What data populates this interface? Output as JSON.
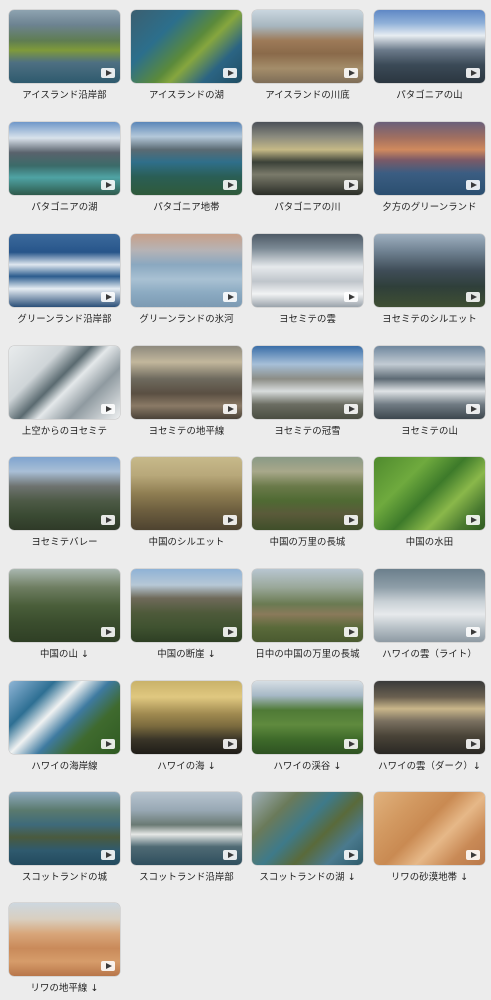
{
  "items": [
    {
      "label": "アイスランド沿岸部",
      "bg": "linear-gradient(180deg,#8ea3b0 0%,#6d8392 20%,#5f7d52 42%,#7f9a3a 55%,#4e6f82 72%,#2e5a6e 100%)"
    },
    {
      "label": "アイスランドの湖",
      "bg": "linear-gradient(135deg,#3b5f70 0%,#2c6f8c 30%,#5b8a3b 52%,#86a63e 60%,#2b6483 78%,#1f4d63 100%)"
    },
    {
      "label": "アイスランドの川底",
      "bg": "linear-gradient(180deg,#c9d6df 0%,#a7b6bf 22%,#9d7a58 42%,#8a6a4a 60%,#a48d6a 80%,#7e6d57 100%)"
    },
    {
      "label": "パタゴニアの山",
      "bg": "linear-gradient(180deg,#5f88c5 0%,#8fb0d8 18%,#e8edf2 35%,#6b7a8a 55%,#3b4a57 75%,#2b3640 100%)"
    },
    {
      "label": "パタゴニアの湖",
      "bg": "linear-gradient(180deg,#6f97c9 0%,#d9e2eb 22%,#59626c 42%,#3b6b69 60%,#4fa3a4 76%,#2e5a4c 100%)"
    },
    {
      "label": "パタゴニア地帯",
      "bg": "linear-gradient(180deg,#5a86b8 0%,#b4c8da 20%,#5a6a72 38%,#2f6f8a 55%,#2a5e55 75%,#2f5a3a 100%)"
    },
    {
      "label": "パタゴニアの川",
      "bg": "linear-gradient(180deg,#4b5058 0%,#8a8a7e 20%,#c5b986 38%,#3b4138 55%,#7a7a6a 72%,#2b2e28 100%)"
    },
    {
      "label": "夕方のグリーンランド",
      "bg": "linear-gradient(180deg,#6a5f7a 0%,#a27060 22%,#d08a5e 38%,#7c5a67 52%,#3b5d82 70%,#2b4f70 100%)"
    },
    {
      "label": "グリーンランド沿岸部",
      "bg": "linear-gradient(180deg,#3c6a9c 0%,#27558a 25%,#dfe7ef 42%,#2c5c8e 58%,#e6edf3 75%,#2a4f78 100%)"
    },
    {
      "label": "グリーンランドの氷河",
      "bg": "linear-gradient(180deg,#c8a089 0%,#b6b3b5 22%,#8aa8c0 42%,#a9c1d3 62%,#8cabc2 80%,#7c9ab3 100%)"
    },
    {
      "label": "ヨセミテの雲",
      "bg": "linear-gradient(180deg,#4e5a66 0%,#7c8a95 20%,#e6e9ec 45%,#bfc5cb 65%,#f2f3f4 82%,#9aa3ab 100%)"
    },
    {
      "label": "ヨセミテのシルエット",
      "bg": "linear-gradient(180deg,#9fb0c0 0%,#6d7f8f 25%,#3f4d58 50%,#2f3f3a 72%,#3f4f33 100%)"
    },
    {
      "label": "上空からのヨセミテ",
      "bg": "linear-gradient(135deg,#e9eced 0%,#cfd5d8 30%,#5a6a70 45%,#e4e8ea 55%,#8f9aa0 72%,#eef0f1 100%)"
    },
    {
      "label": "ヨセミテの地平線",
      "bg": "linear-gradient(180deg,#8e8a7e 0%,#c2b79c 22%,#6e6a5e 45%,#5a4f42 65%,#8a7a66 82%,#4a4238 100%)"
    },
    {
      "label": "ヨセミテの冠雪",
      "bg": "linear-gradient(180deg,#3a6ea8 0%,#a6bfd8 25%,#8c8d86 45%,#d8dcdc 62%,#6b6d62 80%,#4a4e42 100%)"
    },
    {
      "label": "ヨセミテの山",
      "bg": "linear-gradient(180deg,#6f879e 0%,#c2cbd3 25%,#5d6a74 45%,#dfe3e6 62%,#707b83 80%,#3d474e 100%)"
    },
    {
      "label": "ヨセミテバレー",
      "bg": "linear-gradient(180deg,#7fa4cf 0%,#a9bfd6 20%,#6e7370 40%,#4d5a46 60%,#3a4a33 80%,#2f3a28 100%)"
    },
    {
      "label": "中国のシルエット",
      "bg": "linear-gradient(180deg,#c7b98a 0%,#b8a87a 25%,#8f7e52 50%,#6f6040 72%,#4e4330 100%)"
    },
    {
      "label": "中国の万里の長城",
      "bg": "linear-gradient(180deg,#8a9a86 0%,#a8a88a 20%,#6b7a4a 40%,#4f6a33 60%,#5a5a3a 78%,#3f4f2a 100%)"
    },
    {
      "label": "中国の水田",
      "bg": "linear-gradient(135deg,#4f8a2e 0%,#6faa3e 30%,#3d7a2a 50%,#8ab84a 68%,#4a7a30 85%,#2f5a22 100%)"
    },
    {
      "label": "中国の山 ↓",
      "bg": "linear-gradient(180deg,#a9b7b0 0%,#6f7e62 25%,#4a5e3a 50%,#3b4e2e 72%,#2f3f25 100%)"
    },
    {
      "label": "中国の断崖 ↓",
      "bg": "linear-gradient(180deg,#8fb2d6 0%,#b7c8d6 22%,#6f6a5a 40%,#4e5a3a 60%,#3f5230 80%,#2e3f24 100%)"
    },
    {
      "label": "日中の中国の万里の長城",
      "bg": "linear-gradient(180deg,#b8c6d0 0%,#9aa89a 25%,#6a7a52 48%,#8a7a5a 62%,#5a6a3a 80%,#4a5a30 100%)"
    },
    {
      "label": "ハワイの雲（ライト）",
      "bg": "linear-gradient(180deg,#6b7f8c 0%,#8e9ea8 25%,#c9d1d6 45%,#e7eaec 62%,#b9c2c8 80%,#8e9aa3 100%)"
    },
    {
      "label": "ハワイの海岸線",
      "bg": "linear-gradient(135deg,#8fb5d6 0%,#2e6f93 25%,#f0f2f2 40%,#3e7aa0 55%,#3f6a2e 72%,#2f5a22 100%)"
    },
    {
      "label": "ハワイの海 ↓",
      "bg": "linear-gradient(180deg,#c9b26a 0%,#e0c880 22%,#a08a50 45%,#7a6a3e 62%,#3a3528 80%,#1f1d18 100%)"
    },
    {
      "label": "ハワイの渓谷 ↓",
      "bg": "linear-gradient(180deg,#d6dee4 0%,#a6b8c6 20%,#4f7a36 40%,#5f8a3e 60%,#3e6a2a 80%,#2e5222 100%)"
    },
    {
      "label": "ハワイの雲（ダーク）↓",
      "bg": "linear-gradient(180deg,#3a3a3a 0%,#6a6050 22%,#c9b68a 38%,#7a7060 55%,#4a4438 75%,#2a2824 100%)"
    },
    {
      "label": "スコットランドの城",
      "bg": "linear-gradient(180deg,#8ea9be 0%,#5a7a6e 25%,#3e6a7a 45%,#4a5a3e 62%,#2f5a6e 80%,#234a5e 100%)"
    },
    {
      "label": "スコットランド沿岸部",
      "bg": "linear-gradient(180deg,#b7c4cf 0%,#98a8b4 25%,#6a7a74 45%,#e6e8e6 58%,#4f6a74 75%,#2f4f5e 100%)"
    },
    {
      "label": "スコットランドの湖 ↓",
      "bg": "linear-gradient(135deg,#9fb0b8 0%,#6a7a5a 25%,#3e7a8a 45%,#5a6a3a 62%,#4a7a8e 80%,#2e5a6a 100%)"
    },
    {
      "label": "リワの砂漠地帯 ↓",
      "bg": "linear-gradient(135deg,#e0b27e 0%,#d39a62 25%,#c98a52 45%,#e6b888 62%,#c98a56 80%,#b9784a 100%)"
    },
    {
      "label": "リワの地平線 ↓",
      "bg": "linear-gradient(180deg,#cdd7df 0%,#d9cfc0 22%,#d8a67a 42%,#c98a5a 62%,#d69c6a 80%,#b8764a 100%)"
    }
  ]
}
